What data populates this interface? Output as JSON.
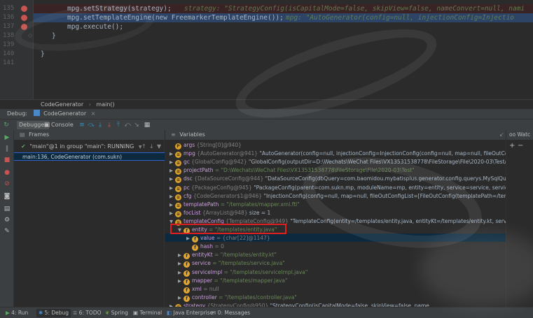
{
  "editor": {
    "lines": [
      {
        "num": "135",
        "code": "mpg.setStrategy(strategy);",
        "hint": "strategy: \"StrategyConfig(isCapitalMode=false, skipView=false, nameConvert=null, nami"
      },
      {
        "num": "136",
        "code": "mpg.setTemplateEngine(new FreemarkerTemplateEngine());",
        "hint": "mpg: \"AutoGenerator(config=null, injectionConfig=Injectio"
      },
      {
        "num": "137",
        "code": "mpg.execute();",
        "hint": ""
      },
      {
        "num": "138",
        "code": "}",
        "hint": ""
      },
      {
        "num": "139",
        "code": "",
        "hint": ""
      },
      {
        "num": "140",
        "code": "}",
        "hint": ""
      },
      {
        "num": "141",
        "code": "",
        "hint": ""
      }
    ]
  },
  "breadcrumb": {
    "class": "CodeGenerator",
    "sep": "›",
    "method": "main()"
  },
  "debug": {
    "label": "Debug:",
    "session": "CodeGenerator",
    "close": "×"
  },
  "toolbar": {
    "debugger_tab": "Debugger",
    "console_tab": "Console"
  },
  "frames": {
    "header": "Frames",
    "thread": "\"main\"@1 in group \"main\": RUNNING",
    "selected_frame": "main:136, CodeGenerator (com.sukn)"
  },
  "variables": {
    "header": "Variables",
    "rows": [
      {
        "indent": 0,
        "tri": "",
        "icon": "P",
        "name": "args",
        "type": "{String[0]@940}",
        "value": ""
      },
      {
        "indent": 0,
        "tri": "▶",
        "icon": "≡",
        "name": "mpg",
        "type": "{AutoGenerator@941}",
        "value": "\"AutoGenerator(config=null, injectionConfig=InjectionConfig(config=null, map=null, fileOutConfigList...",
        "link": "View"
      },
      {
        "indent": 0,
        "tri": "▶",
        "icon": "≡",
        "name": "gc",
        "type": "{GlobalConfig@942}",
        "value": "\"GlobalConfig(outputDir=D:\\Wechats\\WeChat Files\\VX13531538778\\FileStorage\\File\\2020-03\\Test/src/ma...",
        "link": "View"
      },
      {
        "indent": 0,
        "tri": "▶",
        "icon": "≡",
        "name": "projectPath",
        "type": "= \"D:\\Wechats\\WeChat Files\\VX13531538778\\FileStorage\\File\\2020-03\\Test\"",
        "value": ""
      },
      {
        "indent": 0,
        "tri": "▶",
        "icon": "≡",
        "name": "dsc",
        "type": "{DataSourceConfig@944}",
        "value": "\"DataSourceConfig(dbQuery=com.baomidou.mybatisplus.generator.config.querys.MySqlQuery@1...",
        "link": "View"
      },
      {
        "indent": 0,
        "tri": "▶",
        "icon": "≡",
        "name": "pc",
        "type": "{PackageConfig@945}",
        "value": "\"PackageConfig(parent=com.sukn.mp, moduleName=mp, entity=entity, service=service, serviceImpl=service.im...",
        "link": ""
      },
      {
        "indent": 0,
        "tri": "▶",
        "icon": "≡",
        "name": "cfg",
        "type": "{CodeGenerator$1@946}",
        "value": "\"InjectionConfig(config=null, map=null, fileOutConfigList=[FileOutConfig(templatePath=/templates/mapper...",
        "link": ""
      },
      {
        "indent": 0,
        "tri": "▶",
        "icon": "≡",
        "name": "templatePath",
        "type": "= \"/templates/mapper.xml.ftl\"",
        "value": ""
      },
      {
        "indent": 0,
        "tri": "▶",
        "icon": "≡",
        "name": "focList",
        "type": "{ArrayList@948}",
        "value": "size = 1"
      },
      {
        "indent": 0,
        "tri": "▼",
        "icon": "≡",
        "name": "templateConfig",
        "type": "{TemplateConfig@949}",
        "value": "\"TemplateConfig(entity=/templates/entity.java, entityKt=/templates/entity.kt, service=/tem...",
        "link": "View"
      },
      {
        "indent": 1,
        "tri": "▼",
        "icon": "f",
        "name": "entity",
        "type": "= \"/templates/entity.java\"",
        "value": ""
      },
      {
        "indent": 2,
        "tri": "▶",
        "icon": "f",
        "name": "value",
        "type": "= {char[22]@1147}",
        "value": ""
      },
      {
        "indent": 2,
        "tri": "",
        "icon": "f",
        "name": "hash",
        "type": "= 0",
        "value": ""
      },
      {
        "indent": 1,
        "tri": "▶",
        "icon": "f",
        "name": "entityKt",
        "type": "= \"/templates/entity.kt\"",
        "value": ""
      },
      {
        "indent": 1,
        "tri": "▶",
        "icon": "f",
        "name": "service",
        "type": "= \"/templates/service.java\"",
        "value": ""
      },
      {
        "indent": 1,
        "tri": "▶",
        "icon": "f",
        "name": "serviceImpl",
        "type": "= \"/templates/serviceImpl.java\"",
        "value": ""
      },
      {
        "indent": 1,
        "tri": "▶",
        "icon": "f",
        "name": "mapper",
        "type": "= \"/templates/mapper.java\"",
        "value": ""
      },
      {
        "indent": 1,
        "tri": "",
        "icon": "f",
        "name": "xml",
        "type": "= null",
        "value": ""
      },
      {
        "indent": 1,
        "tri": "▶",
        "icon": "f",
        "name": "controller",
        "type": "= \"/templates/controller.java\"",
        "value": ""
      },
      {
        "indent": 0,
        "tri": "▶",
        "icon": "≡",
        "name": "strategy",
        "type": "{StrategyConfig@950}",
        "value": "\"StrategyConfig(isCapitalMode=false, skipView=false, name...",
        "link": ""
      }
    ]
  },
  "watches": {
    "header": "oo Watc"
  },
  "bottombar": {
    "tabs": [
      "4: Run",
      "5: Debug",
      "6: TODO",
      "Spring",
      "Terminal",
      "Java Enterprise",
      "0: Messages"
    ]
  }
}
